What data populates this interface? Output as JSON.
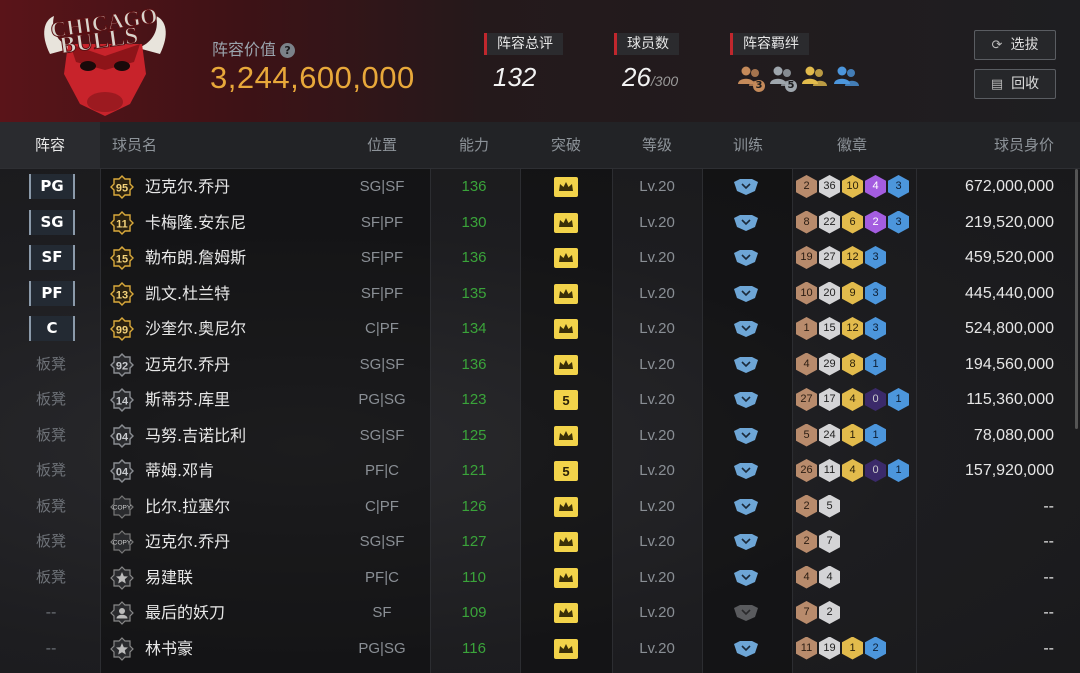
{
  "header": {
    "lineup_value_label": "阵容价值",
    "lineup_value": "3,244,600,000",
    "total_rating_label": "阵容总评",
    "total_rating": "132",
    "player_count_label": "球员数",
    "player_count": "26",
    "player_count_max": "/300",
    "bonds_label": "阵容羁绊",
    "bonds": [
      {
        "icon": "bond-people-icon",
        "level": "3",
        "color": "#c58a5a"
      },
      {
        "icon": "bond-people-icon",
        "level": "5",
        "color": "#9fa6ad"
      },
      {
        "icon": "bond-people-icon",
        "level": "",
        "color": "#e2bb4c"
      },
      {
        "icon": "bond-people-icon",
        "level": "",
        "color": "#4c96dc"
      }
    ],
    "draft_button": "选拔",
    "recycle_button": "回收",
    "logo_text": "CHICAGO BULLS"
  },
  "table": {
    "headers": {
      "lineup": "阵容",
      "name": "球员名",
      "position": "位置",
      "ability": "能力",
      "breakthrough": "突破",
      "level": "等级",
      "training": "训练",
      "badges": "徽章",
      "value": "球员身价"
    },
    "rows": [
      {
        "slot": "PG",
        "starter": true,
        "rating": "95",
        "rating_style": "gold",
        "name": "迈克尔.乔丹",
        "position": "SG|SF",
        "ability": "136",
        "break": "crown",
        "level": "Lv.20",
        "train": "blue",
        "badges": [
          [
            "b-br",
            "2"
          ],
          [
            "b-si",
            "36"
          ],
          [
            "b-go",
            "10"
          ],
          [
            "b-pu",
            "4"
          ],
          [
            "b-bl",
            "3"
          ]
        ],
        "value": "672,000,000"
      },
      {
        "slot": "SG",
        "starter": true,
        "rating": "11",
        "rating_style": "gold",
        "name": "卡梅隆.安东尼",
        "position": "SF|PF",
        "ability": "130",
        "break": "crown",
        "level": "Lv.20",
        "train": "blue",
        "badges": [
          [
            "b-br",
            "8"
          ],
          [
            "b-si",
            "22"
          ],
          [
            "b-go",
            "6"
          ],
          [
            "b-pu",
            "2"
          ],
          [
            "b-bl",
            "3"
          ]
        ],
        "value": "219,520,000"
      },
      {
        "slot": "SF",
        "starter": true,
        "rating": "15",
        "rating_style": "gold",
        "name": "勒布朗.詹姆斯",
        "position": "SF|PF",
        "ability": "136",
        "break": "crown",
        "level": "Lv.20",
        "train": "blue",
        "badges": [
          [
            "b-br",
            "19"
          ],
          [
            "b-si",
            "27"
          ],
          [
            "b-go",
            "12"
          ],
          [
            "b-bl",
            "3"
          ]
        ],
        "value": "459,520,000"
      },
      {
        "slot": "PF",
        "starter": true,
        "rating": "13",
        "rating_style": "gold",
        "name": "凯文.杜兰特",
        "position": "SF|PF",
        "ability": "135",
        "break": "crown",
        "level": "Lv.20",
        "train": "blue",
        "badges": [
          [
            "b-br",
            "10"
          ],
          [
            "b-si",
            "20"
          ],
          [
            "b-go",
            "9"
          ],
          [
            "b-bl",
            "3"
          ]
        ],
        "value": "445,440,000"
      },
      {
        "slot": "C",
        "starter": true,
        "rating": "99",
        "rating_style": "gold",
        "name": "沙奎尔.奥尼尔",
        "position": "C|PF",
        "ability": "134",
        "break": "crown",
        "level": "Lv.20",
        "train": "blue",
        "badges": [
          [
            "b-br",
            "1"
          ],
          [
            "b-si",
            "15"
          ],
          [
            "b-go",
            "12"
          ],
          [
            "b-bl",
            "3"
          ]
        ],
        "value": "524,800,000"
      },
      {
        "slot": "板凳",
        "starter": false,
        "rating": "92",
        "rating_style": "silver",
        "name": "迈克尔.乔丹",
        "position": "SG|SF",
        "ability": "136",
        "break": "crown",
        "level": "Lv.20",
        "train": "blue",
        "badges": [
          [
            "b-br",
            "4"
          ],
          [
            "b-si",
            "29"
          ],
          [
            "b-go",
            "8"
          ],
          [
            "b-bl",
            "1"
          ]
        ],
        "value": "194,560,000"
      },
      {
        "slot": "板凳",
        "starter": false,
        "rating": "14",
        "rating_style": "silver",
        "name": "斯蒂芬.库里",
        "position": "PG|SG",
        "ability": "123",
        "break": "5",
        "level": "Lv.20",
        "train": "blue",
        "badges": [
          [
            "b-br",
            "27"
          ],
          [
            "b-si",
            "17"
          ],
          [
            "b-go",
            "4"
          ],
          [
            "b-dk",
            "0"
          ],
          [
            "b-bl",
            "1"
          ]
        ],
        "value": "115,360,000"
      },
      {
        "slot": "板凳",
        "starter": false,
        "rating": "04",
        "rating_style": "silver",
        "name": "马努.吉诺比利",
        "position": "SG|SF",
        "ability": "125",
        "break": "crown",
        "level": "Lv.20",
        "train": "blue",
        "badges": [
          [
            "b-br",
            "5"
          ],
          [
            "b-si",
            "24"
          ],
          [
            "b-go",
            "1"
          ],
          [
            "b-bl",
            "1"
          ]
        ],
        "value": "78,080,000"
      },
      {
        "slot": "板凳",
        "starter": false,
        "rating": "04",
        "rating_style": "silver",
        "name": "蒂姆.邓肯",
        "position": "PF|C",
        "ability": "121",
        "break": "5",
        "level": "Lv.20",
        "train": "blue",
        "badges": [
          [
            "b-br",
            "26"
          ],
          [
            "b-si",
            "11"
          ],
          [
            "b-go",
            "4"
          ],
          [
            "b-dk",
            "0"
          ],
          [
            "b-bl",
            "1"
          ]
        ],
        "value": "157,920,000"
      },
      {
        "slot": "板凳",
        "starter": false,
        "rating": "COPY",
        "rating_style": "copy",
        "name": "比尔.拉塞尔",
        "position": "C|PF",
        "ability": "126",
        "break": "crown",
        "level": "Lv.20",
        "train": "blue",
        "badges": [
          [
            "b-br",
            "2"
          ],
          [
            "b-si",
            "5"
          ]
        ],
        "value": "--"
      },
      {
        "slot": "板凳",
        "starter": false,
        "rating": "COPY",
        "rating_style": "copy",
        "name": "迈克尔.乔丹",
        "position": "SG|SF",
        "ability": "127",
        "break": "crown",
        "level": "Lv.20",
        "train": "blue",
        "badges": [
          [
            "b-br",
            "2"
          ],
          [
            "b-si",
            "7"
          ]
        ],
        "value": "--"
      },
      {
        "slot": "板凳",
        "starter": false,
        "rating": "",
        "rating_style": "star",
        "name": "易建联",
        "position": "PF|C",
        "ability": "110",
        "break": "crown",
        "level": "Lv.20",
        "train": "blue",
        "badges": [
          [
            "b-br",
            "4"
          ],
          [
            "b-si",
            "4"
          ]
        ],
        "value": "--"
      },
      {
        "slot": "--",
        "starter": false,
        "rating": "",
        "rating_style": "person",
        "name": "最后的妖刀",
        "position": "SF",
        "ability": "109",
        "break": "crown",
        "level": "Lv.20",
        "train": "gray",
        "badges": [
          [
            "b-br",
            "7"
          ],
          [
            "b-si",
            "2"
          ]
        ],
        "value": "--"
      },
      {
        "slot": "--",
        "starter": false,
        "rating": "",
        "rating_style": "star",
        "name": "林书豪",
        "position": "PG|SG",
        "ability": "116",
        "break": "crown",
        "level": "Lv.20",
        "train": "blue",
        "badges": [
          [
            "b-br",
            "11"
          ],
          [
            "b-si",
            "19"
          ],
          [
            "b-go",
            "1"
          ],
          [
            "b-bl",
            "2"
          ]
        ],
        "value": "--"
      }
    ]
  }
}
